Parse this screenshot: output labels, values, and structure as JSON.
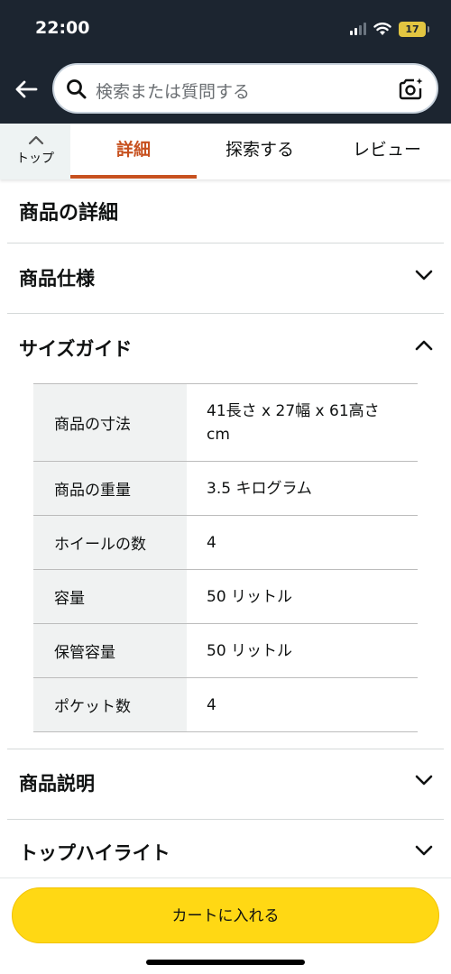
{
  "status_bar": {
    "time": "22:00",
    "battery": "17"
  },
  "search": {
    "placeholder": "検索または質問する"
  },
  "tabs": {
    "top_label": "トップ",
    "items": [
      {
        "label": "詳細",
        "active": true
      },
      {
        "label": "探索する",
        "active": false
      },
      {
        "label": "レビュー",
        "active": false
      }
    ]
  },
  "details": {
    "title": "商品の詳細",
    "sections": [
      {
        "label": "商品仕様",
        "expanded": false
      },
      {
        "label": "サイズガイド",
        "expanded": true
      },
      {
        "label": "商品説明",
        "expanded": false
      },
      {
        "label": "トップハイライト",
        "expanded": false
      }
    ],
    "size_guide": [
      {
        "key": "商品の寸法",
        "value": "41長さ x 27幅 x 61高さ cm"
      },
      {
        "key": "商品の重量",
        "value": "3.5 キログラム"
      },
      {
        "key": "ホイールの数",
        "value": "4"
      },
      {
        "key": "容量",
        "value": "50 リットル"
      },
      {
        "key": "保管容量",
        "value": "50 リットル"
      },
      {
        "key": "ポケット数",
        "value": "4"
      }
    ]
  },
  "cart": {
    "label": "カートに入れる"
  },
  "colors": {
    "header": "#1c2530",
    "accent": "#c7511f",
    "cart_button": "#ffd814"
  }
}
